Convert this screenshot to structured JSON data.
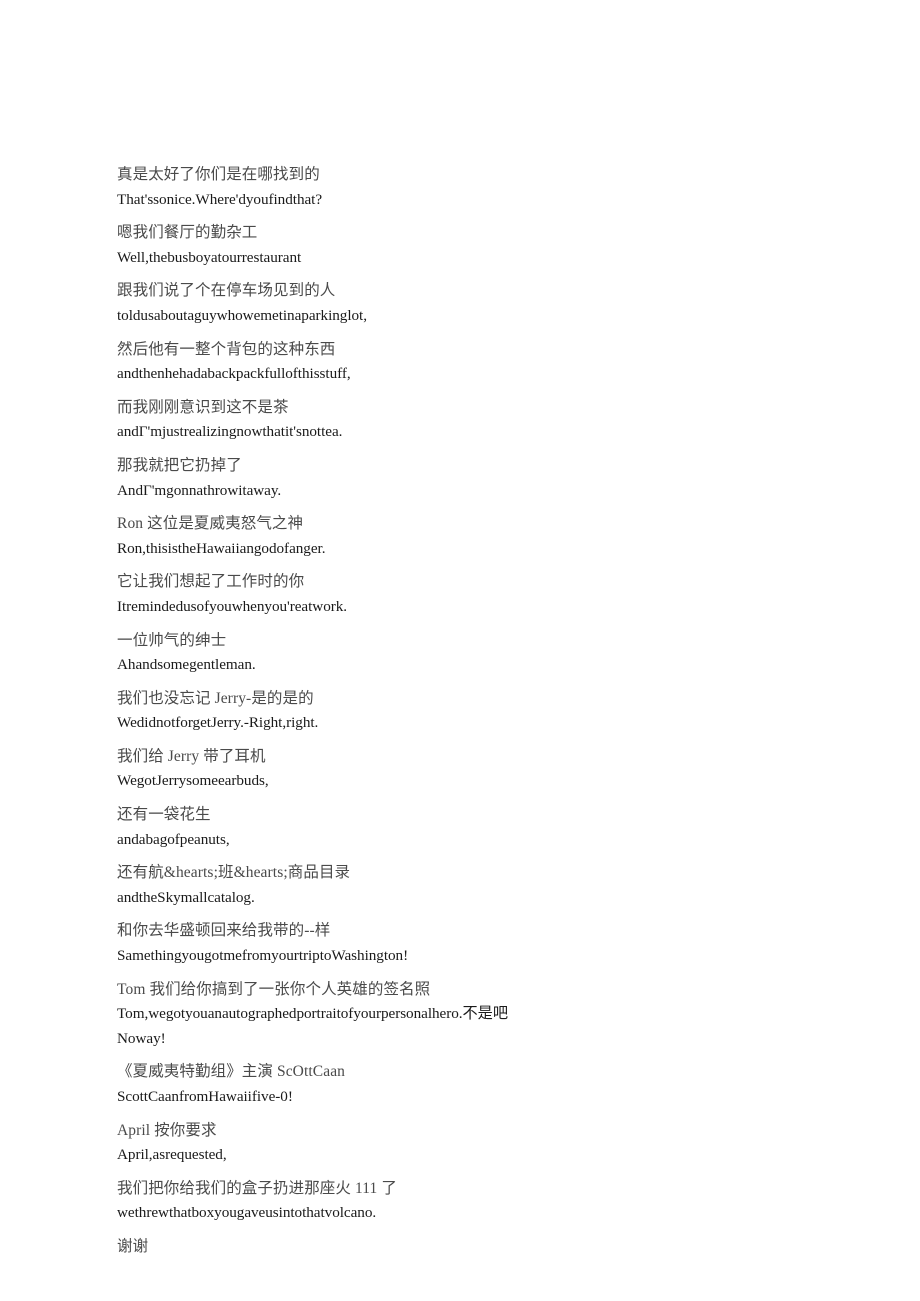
{
  "document": {
    "kind": "bilingual-subtitle-transcript",
    "page_background": "#ffffff",
    "zh_color": "#4a4a4a",
    "en_color": "#1a1a1a"
  },
  "stanzas": [
    {
      "zh": "真是太好了你们是在哪找到的",
      "en": "That'ssonice.Where'dyoufindthat?"
    },
    {
      "zh": "嗯我们餐厅的勤杂工",
      "en": "Well,thebusboyatourrestaurant"
    },
    {
      "zh": "跟我们说了个在停车场见到的人",
      "en": "toldusaboutaguywhowemetinaparkinglot,"
    },
    {
      "zh": "然后他有一整个背包的这种东西",
      "en": "andthenhehadabackpackfullofthisstuff,"
    },
    {
      "zh": "而我刚刚意识到这不是茶",
      "en": "andΓ'mjustrealizingnowthatit'snottea."
    },
    {
      "zh": "那我就把它扔掉了",
      "en": "AndΓ'mgonnathrowitaway."
    },
    {
      "zh": "Ron 这位是夏威夷怒气之神",
      "en": "Ron,thisistheHawaiiangodofanger."
    },
    {
      "zh": "它让我们想起了工作时的你",
      "en": "Itremindedusofyouwhenyou'reatwork."
    },
    {
      "zh": "一位帅气的绅士",
      "en": "Ahandsomegentleman."
    },
    {
      "zh": "我们也没忘记 Jerry-是的是的",
      "en": "WedidnotforgetJerry.-Right,right."
    },
    {
      "zh": "我们给 Jerry 带了耳机",
      "en": "WegotJerrysomeearbuds,"
    },
    {
      "zh": "还有一袋花生",
      "en": "andabagofpeanuts,"
    },
    {
      "zh": "还有航&hearts;班&hearts;商品目录",
      "en": "andtheSkymallcatalog."
    },
    {
      "zh": "和你去华盛顿回来给我带的--样",
      "en": "SamethingyougotmefromyourtriptoWashington!"
    },
    {
      "zh": "Tom 我们给你搞到了一张你个人英雄的签名照",
      "en": "Tom,wegotyouanautographedportraitofyourpersonalhero.不是吧",
      "extra": "Noway!"
    },
    {
      "zh": "《夏威夷特勤组》主演 ScOttCaan",
      "en": "ScottCaanfromHawaiifive-0!"
    },
    {
      "zh": "April 按你要求",
      "en": "April,asrequested,"
    },
    {
      "zh": "我们把你给我们的盒子扔进那座火 111 了",
      "en": "wethrewthatboxyougaveusintothatvolcano."
    },
    {
      "zh": "谢谢",
      "en": ""
    }
  ]
}
